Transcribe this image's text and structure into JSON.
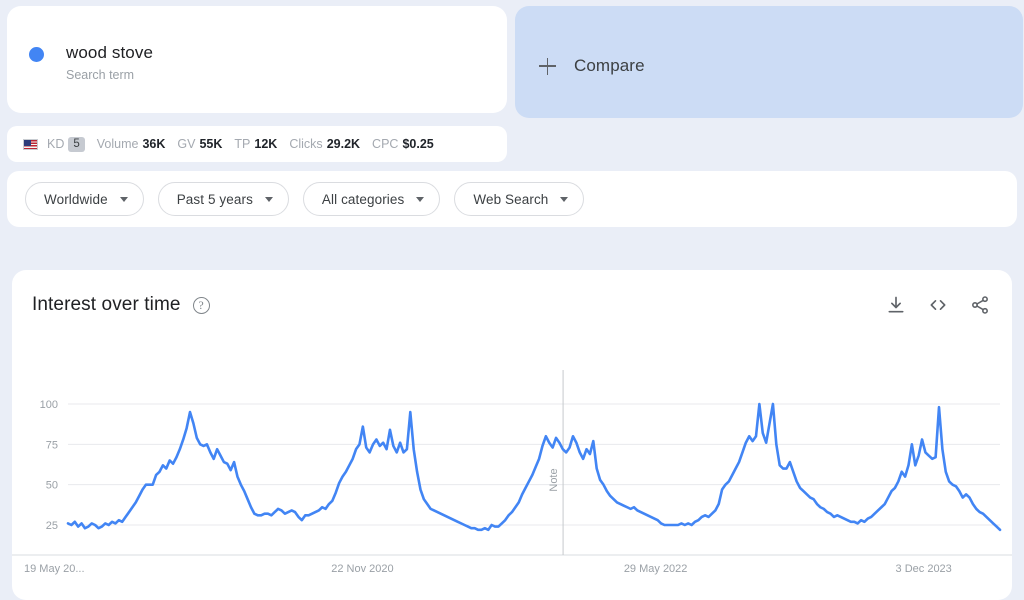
{
  "search_term": {
    "name": "wood stove",
    "type_label": "Search term",
    "dot_color": "#4285f4"
  },
  "compare": {
    "label": "Compare",
    "icon": "plus-icon",
    "background": "#ccdcf5"
  },
  "metrics": {
    "country_icon": "us-flag-icon",
    "items": [
      {
        "label": "KD",
        "value": "5",
        "badge": true
      },
      {
        "label": "Volume",
        "value": "36K",
        "badge": false
      },
      {
        "label": "GV",
        "value": "55K",
        "badge": false
      },
      {
        "label": "TP",
        "value": "12K",
        "badge": false
      },
      {
        "label": "Clicks",
        "value": "29.2K",
        "badge": false
      },
      {
        "label": "CPC",
        "value": "$0.25",
        "badge": false
      }
    ]
  },
  "filters": [
    {
      "label": "Worldwide",
      "name": "filter-location"
    },
    {
      "label": "Past 5 years",
      "name": "filter-time-range"
    },
    {
      "label": "All categories",
      "name": "filter-category"
    },
    {
      "label": "Web Search",
      "name": "filter-search-type"
    }
  ],
  "chart_panel": {
    "title": "Interest over time",
    "help_glyph": "?",
    "actions": [
      {
        "name": "download-icon",
        "tooltip": "Download"
      },
      {
        "name": "embed-code-icon",
        "tooltip": "Embed"
      },
      {
        "name": "share-icon",
        "tooltip": "Share"
      }
    ]
  },
  "chart_data": {
    "type": "line",
    "title": "Interest over time",
    "xlabel": "",
    "ylabel": "",
    "ylim": [
      0,
      100
    ],
    "yticks": [
      25,
      50,
      75,
      100
    ],
    "grid": true,
    "legend": false,
    "line_color": "#4285f4",
    "xticks": [
      "19 May 20...",
      "22 Nov 2020",
      "29 May 2022",
      "3 Dec 2023"
    ],
    "xtick_positions": [
      0.0,
      0.3159,
      0.6305,
      0.9181
    ],
    "annotations": [
      {
        "label": "Note",
        "x_fraction": 0.5312,
        "orientation": "vertical"
      }
    ],
    "series": [
      {
        "name": "wood stove",
        "values": [
          26,
          25,
          27,
          24,
          26,
          23,
          24,
          26,
          25,
          23,
          24,
          26,
          25,
          27,
          26,
          28,
          27,
          30,
          33,
          36,
          39,
          43,
          47,
          50,
          50,
          50,
          56,
          58,
          62,
          60,
          65,
          63,
          67,
          72,
          78,
          85,
          95,
          88,
          79,
          75,
          74,
          75,
          70,
          66,
          72,
          68,
          64,
          63,
          59,
          64,
          55,
          50,
          46,
          41,
          36,
          32,
          31,
          31,
          32,
          32,
          31,
          33,
          35,
          34,
          32,
          33,
          34,
          33,
          30,
          28,
          31,
          31,
          32,
          33,
          34,
          36,
          35,
          38,
          40,
          45,
          51,
          55,
          58,
          62,
          66,
          72,
          75,
          86,
          73,
          70,
          75,
          78,
          74,
          76,
          72,
          84,
          74,
          70,
          76,
          70,
          72,
          95,
          72,
          58,
          47,
          41,
          38,
          35,
          34,
          33,
          32,
          31,
          30,
          29,
          28,
          27,
          26,
          25,
          24,
          23,
          23,
          22,
          22,
          23,
          22,
          25,
          24,
          24,
          26,
          28,
          31,
          33,
          36,
          39,
          44,
          48,
          52,
          56,
          61,
          66,
          74,
          80,
          76,
          73,
          79,
          76,
          72,
          70,
          73,
          80,
          76,
          70,
          66,
          72,
          69,
          77,
          60,
          53,
          50,
          46,
          43,
          41,
          39,
          38,
          37,
          36,
          35,
          36,
          34,
          33,
          32,
          31,
          30,
          29,
          28,
          26,
          25,
          25,
          25,
          25,
          25,
          26,
          25,
          26,
          25,
          27,
          28,
          30,
          31,
          30,
          32,
          34,
          38,
          47,
          50,
          52,
          56,
          60,
          64,
          70,
          76,
          80,
          77,
          80,
          100,
          82,
          76,
          88,
          100,
          75,
          62,
          60,
          60,
          64,
          58,
          52,
          48,
          46,
          44,
          42,
          41,
          38,
          36,
          35,
          33,
          32,
          30,
          31,
          30,
          29,
          28,
          27,
          27,
          26,
          28,
          27,
          29,
          30,
          32,
          34,
          36,
          38,
          42,
          46,
          48,
          52,
          58,
          55,
          62,
          75,
          62,
          68,
          78,
          70,
          68,
          66,
          67,
          98,
          72,
          58,
          52,
          50,
          49,
          46,
          42,
          44,
          42,
          38,
          35,
          33,
          32,
          30,
          28,
          26,
          24,
          22
        ]
      }
    ]
  }
}
